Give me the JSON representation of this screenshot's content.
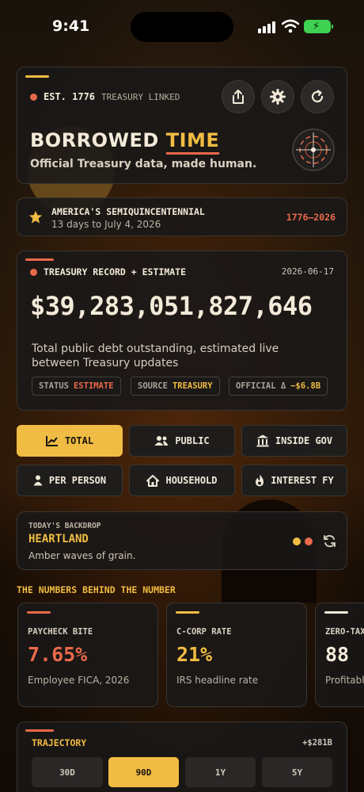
{
  "status_bar": {
    "time": "9:41"
  },
  "header": {
    "badge_est": "EST. 1776",
    "badge_linked": "TREASURY LINKED",
    "title_part1": "BORROWED",
    "title_part2": "TIME",
    "tagline": "Official Treasury data, made human.",
    "icons": [
      "share-icon",
      "gear-icon",
      "refresh-icon",
      "crosshair-icon"
    ]
  },
  "banner": {
    "title": "AMERICA'S SEMIQUINCENTENNIAL",
    "subtitle": "13 days to July 4, 2026",
    "range": "1776–2026"
  },
  "debt": {
    "label": "TREASURY RECORD + ESTIMATE",
    "date": "2026-06-17",
    "amount": "$39,283,051,827,646",
    "description": "Total public debt outstanding, estimated live between Treasury updates",
    "pills": [
      {
        "key": "STATUS",
        "value": "ESTIMATE"
      },
      {
        "key": "SOURCE",
        "value": "TREASURY"
      },
      {
        "key": "OFFICIAL Δ",
        "value": "−$6.8B"
      }
    ]
  },
  "views": [
    {
      "label": "TOTAL",
      "icon": "chart-line-icon",
      "active": true
    },
    {
      "label": "PUBLIC",
      "icon": "users-icon",
      "active": false
    },
    {
      "label": "INSIDE GOV",
      "icon": "bank-icon",
      "active": false
    },
    {
      "label": "PER PERSON",
      "icon": "person-icon",
      "active": false
    },
    {
      "label": "HOUSEHOLD",
      "icon": "house-icon",
      "active": false
    },
    {
      "label": "INTEREST FY",
      "icon": "flame-icon",
      "active": false
    }
  ],
  "backdrop": {
    "label": "TODAY'S BACKDROP",
    "title": "HEARTLAND",
    "subtitle": "Amber waves of grain."
  },
  "numbers": {
    "section_title": "THE NUMBERS BEHIND THE NUMBER",
    "cards": [
      {
        "label": "PAYCHECK BITE",
        "value": "7.65%",
        "sub": "Employee FICA, 2026",
        "color": "#e8694a"
      },
      {
        "label": "C-CORP RATE",
        "value": "21%",
        "sub": "IRS headline rate",
        "color": "#f1bc43"
      },
      {
        "label": "ZERO-TAX",
        "value": "88",
        "sub": "Profitable",
        "color": "#f3ead9"
      }
    ]
  },
  "trajectory": {
    "title": "TRAJECTORY",
    "delta": "+$281B",
    "ranges": [
      {
        "label": "30D",
        "active": false
      },
      {
        "label": "90D",
        "active": true
      },
      {
        "label": "1Y",
        "active": false
      },
      {
        "label": "5Y",
        "active": false
      }
    ]
  },
  "colors": {
    "accent_red": "#e8694a",
    "accent_gold": "#f1bc43",
    "card_bg": "#191818"
  }
}
